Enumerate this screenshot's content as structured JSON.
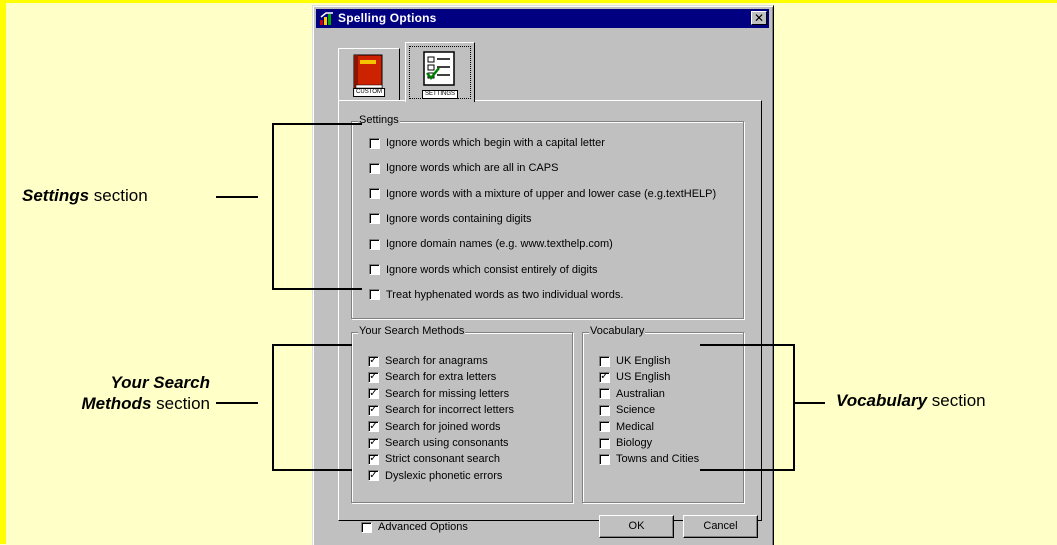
{
  "dialog": {
    "title": "Spelling Options",
    "close_glyph": "✕",
    "icons": {
      "title": "book-icon",
      "custom_tab": "red-book-icon",
      "settings_tab": "checklist-icon"
    },
    "tabs": [
      {
        "label": "CUSTOM",
        "selected": false
      },
      {
        "label": "SETTINGS",
        "selected": true
      }
    ],
    "settings": {
      "title": "Settings",
      "items": [
        {
          "label": "Ignore words which begin with a capital letter",
          "checked": false
        },
        {
          "label": "Ignore words which are all in CAPS",
          "checked": false
        },
        {
          "label": "Ignore words with a mixture of upper and lower case (e.g.textHELP)",
          "checked": false
        },
        {
          "label": "Ignore words containing digits",
          "checked": false
        },
        {
          "label": "Ignore domain names (e.g. www.texthelp.com)",
          "checked": false
        },
        {
          "label": "Ignore words which consist entirely of digits",
          "checked": false
        },
        {
          "label": "Treat hyphenated words as two individual words.",
          "checked": false
        }
      ]
    },
    "search": {
      "title": "Your Search Methods",
      "items": [
        {
          "label": "Search for anagrams",
          "checked": true
        },
        {
          "label": "Search for extra letters",
          "checked": true
        },
        {
          "label": "Search for missing letters",
          "checked": true
        },
        {
          "label": "Search for incorrect letters",
          "checked": true
        },
        {
          "label": "Search for joined words",
          "checked": true
        },
        {
          "label": "Search using consonants",
          "checked": true
        },
        {
          "label": "Strict consonant search",
          "checked": true
        },
        {
          "label": "Dyslexic phonetic errors",
          "checked": true
        }
      ]
    },
    "vocabulary": {
      "title": "Vocabulary",
      "items": [
        {
          "label": "UK English",
          "checked": false
        },
        {
          "label": "US English",
          "checked": true
        },
        {
          "label": "Australian",
          "checked": false
        },
        {
          "label": "Science",
          "checked": false
        },
        {
          "label": "Medical",
          "checked": false
        },
        {
          "label": "Biology",
          "checked": false
        },
        {
          "label": "Towns and Cities",
          "checked": false
        }
      ]
    },
    "advanced": {
      "label": "Advanced Options",
      "checked": false
    },
    "ok_label": "OK",
    "cancel_label": "Cancel"
  },
  "annotations": {
    "settings": {
      "bold": "Settings",
      "rest": " section"
    },
    "search": {
      "line1": "Your Search",
      "bold2": "Methods",
      "rest2": " section"
    },
    "vocabulary": {
      "bold": "Vocabulary",
      "rest": " section"
    }
  },
  "colors": {
    "background": "#FFFFC8",
    "frame": "#FFFF00",
    "titlebar": "#000080",
    "dialog_face": "#C0C0C0"
  }
}
